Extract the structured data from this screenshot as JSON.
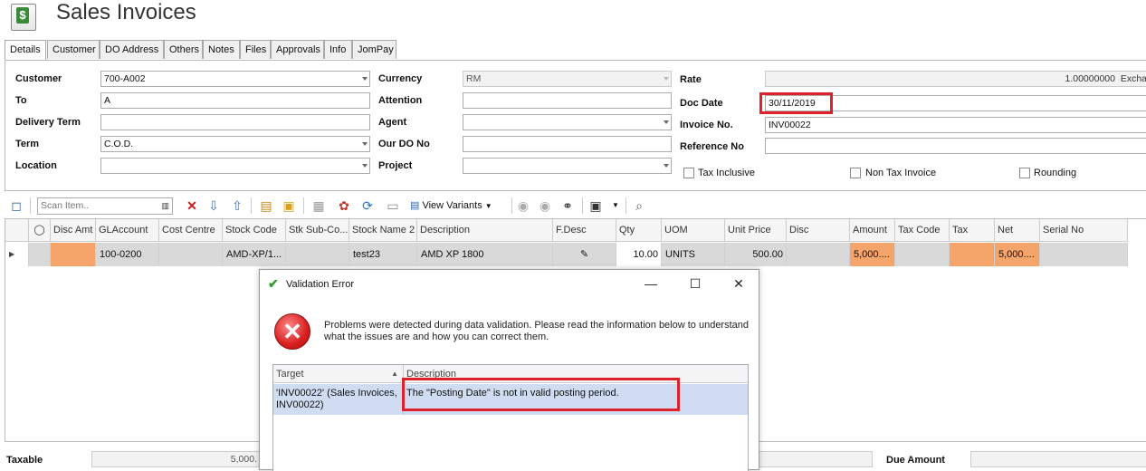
{
  "window": {
    "title": "Sales Invoices"
  },
  "tabs": [
    "Details",
    "Customer",
    "DO Address",
    "Others",
    "Notes",
    "Files",
    "Approvals",
    "Info",
    "JomPay"
  ],
  "form": {
    "customer": {
      "label": "Customer",
      "value": "700-A002"
    },
    "to": {
      "label": "To",
      "value": "A"
    },
    "delivery_term": {
      "label": "Delivery Term",
      "value": ""
    },
    "term": {
      "label": "Term",
      "value": "C.O.D."
    },
    "location": {
      "label": "Location",
      "value": ""
    },
    "currency": {
      "label": "Currency",
      "value": "RM"
    },
    "attention": {
      "label": "Attention",
      "value": ""
    },
    "agent": {
      "label": "Agent",
      "value": ""
    },
    "our_do_no": {
      "label": "Our DO No",
      "value": ""
    },
    "project": {
      "label": "Project",
      "value": ""
    },
    "rate": {
      "label": "Rate",
      "value": "1.00000000",
      "suffix": "Excha"
    },
    "doc_date": {
      "label": "Doc Date",
      "value": "30/11/2019"
    },
    "invoice_no": {
      "label": "Invoice No.",
      "value": "INV00022"
    },
    "reference_no": {
      "label": "Reference No",
      "value": ""
    },
    "tax_inclusive": "Tax Inclusive",
    "non_tax_invoice": "Non Tax Invoice",
    "rounding": "Rounding"
  },
  "toolbar": {
    "scan_placeholder": "Scan Item..",
    "view_variants": "View Variants"
  },
  "grid": {
    "columns": [
      "Disc Amt",
      "GLAccount",
      "Cost Centre",
      "Stock Code",
      "Stk Sub-Co...",
      "Stock Name 2",
      "Description",
      "F.Desc",
      "Qty",
      "UOM",
      "Unit Price",
      "Disc",
      "Amount",
      "Tax Code",
      "Tax",
      "Net",
      "Serial No"
    ],
    "row": {
      "disc_amt": "",
      "gl_account": "100-0200",
      "cost_centre": "",
      "stock_code": "AMD-XP/1...",
      "stk_sub_code": "",
      "stock_name_2": "test23",
      "description": "AMD XP 1800",
      "qty": "10.00",
      "uom": "UNITS",
      "unit_price": "500.00",
      "disc": "",
      "amount": "5,000....",
      "tax_code": "",
      "tax": "",
      "net": "5,000....",
      "serial_no": ""
    }
  },
  "footer": {
    "taxable_label": "Taxable",
    "taxable_value": "5,000.",
    "due_amount_label": "Due Amount"
  },
  "dialog": {
    "title": "Validation Error",
    "message": "Problems were detected during data validation. Please read the information below to understand what the issues are and how you can correct them.",
    "columns": [
      "Target",
      "Description"
    ],
    "rows": [
      {
        "target": "'INV00022' (Sales Invoices, INV00022)",
        "description": "The \"Posting Date\" is not in valid posting period."
      }
    ]
  },
  "colors": {
    "highlight": "#e0202a",
    "orange_cell": "#f5a46a",
    "selected_row": "#cfdcf2"
  }
}
